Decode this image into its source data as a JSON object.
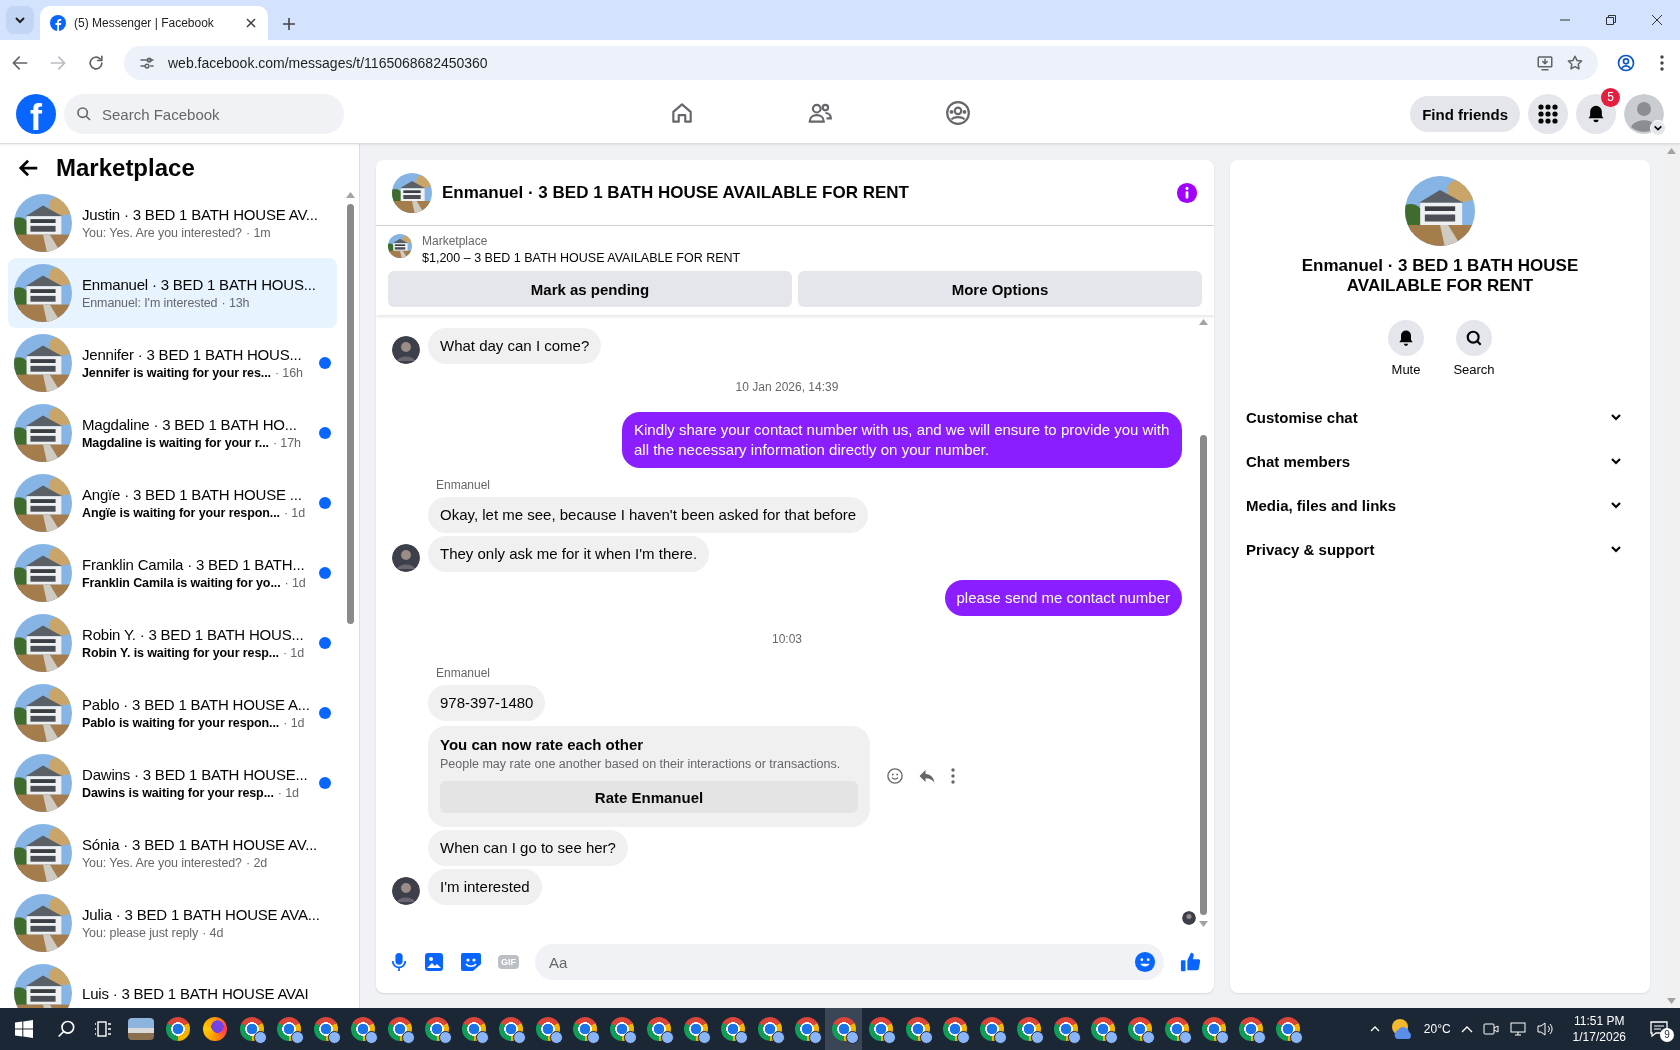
{
  "browser": {
    "tab_title": "(5) Messenger | Facebook",
    "url": "web.facebook.com/messages/t/1165068682450360"
  },
  "nav": {
    "logo": "f",
    "search_placeholder": "Search Facebook",
    "tabs": [
      {
        "kind": "home",
        "selected": false
      },
      {
        "kind": "friends",
        "selected": false
      },
      {
        "kind": "groups",
        "selected": false
      }
    ],
    "find_friends": "Find friends",
    "notification_count": "5"
  },
  "sidebar": {
    "title": "Marketplace",
    "chats": [
      {
        "title": "Justin · 3 BED 1 BATH HOUSE AV...",
        "preview": "You: Yes. Are you interested?",
        "time": "· 1m",
        "unread": false,
        "selected": false
      },
      {
        "title": "Enmanuel · 3 BED 1 BATH HOUS...",
        "preview": "Enmanuel: I'm interested",
        "time": "· 13h",
        "unread": false,
        "selected": true
      },
      {
        "title": "Jennifer · 3 BED 1 BATH HOUS...",
        "preview": "Jennifer is waiting for your res...",
        "time": "· 16h",
        "unread": true,
        "selected": false
      },
      {
        "title": "Magdaline · 3 BED 1 BATH HO...",
        "preview": "Magdaline is waiting for your r...",
        "time": "· 17h",
        "unread": true,
        "selected": false
      },
      {
        "title": "Angïe · 3 BED 1 BATH HOUSE ...",
        "preview": "Angïe is waiting for your respon...",
        "time": "· 1d",
        "unread": true,
        "selected": false
      },
      {
        "title": "Franklin Camila · 3 BED 1 BATH...",
        "preview": "Franklin Camila is waiting for yo...",
        "time": "· 1d",
        "unread": true,
        "selected": false
      },
      {
        "title": "Robin Y. · 3 BED 1 BATH HOUS...",
        "preview": "Robin Y. is waiting for your resp...",
        "time": "· 1d",
        "unread": true,
        "selected": false
      },
      {
        "title": "Pablo · 3 BED 1 BATH HOUSE A...",
        "preview": "Pablo is waiting for your respon...",
        "time": "· 1d",
        "unread": true,
        "selected": false
      },
      {
        "title": "Dawins · 3 BED 1 BATH HOUSE...",
        "preview": "Dawins is waiting for your resp...",
        "time": "· 1d",
        "unread": true,
        "selected": false
      },
      {
        "title": "Sónia · 3 BED 1 BATH HOUSE AV...",
        "preview": "You: Yes. Are you interested?",
        "time": "· 2d",
        "unread": false,
        "selected": false
      },
      {
        "title": "Julia · 3 BED 1 BATH HOUSE AVA...",
        "preview": "You: please just reply",
        "time": "· 4d",
        "unread": false,
        "selected": false
      },
      {
        "title": "Luis · 3 BED 1 BATH HOUSE AVAI",
        "unread": false,
        "selected": false
      }
    ]
  },
  "conversation": {
    "title": "Enmanuel · 3 BED 1 BATH HOUSE AVAILABLE FOR RENT",
    "listing": {
      "label": "Marketplace",
      "detail": "$1,200 – 3 BED 1 BATH HOUSE AVAILABLE FOR RENT"
    },
    "actions": [
      "Mark as pending",
      "More Options"
    ],
    "messages": [
      {
        "kind": "incoming",
        "text": "What day can I come?",
        "avatar": true
      },
      {
        "kind": "timestamp",
        "text": "10 Jan 2026, 14:39"
      },
      {
        "kind": "outgoing",
        "text": "Kindly share your contact number with us, and we will ensure to provide you with all the necessary information directly on your number."
      },
      {
        "kind": "sender",
        "text": "Enmanuel"
      },
      {
        "kind": "incoming",
        "text": "Okay, let me see, because I haven't been asked for that before",
        "avatar": false
      },
      {
        "kind": "incoming",
        "text": "They only ask me for it when I'm there.",
        "avatar": true
      },
      {
        "kind": "outgoing",
        "text": "please send me contact number"
      },
      {
        "kind": "timestamp",
        "text": "10:03"
      },
      {
        "kind": "sender",
        "text": "Enmanuel"
      },
      {
        "kind": "incoming",
        "text": "978-397-1480",
        "avatar": false
      },
      {
        "kind": "rating",
        "title": "You can now rate each other",
        "text": "People may rate one another based on their interactions or transactions.",
        "button": "Rate Enmanuel",
        "hovered": true
      },
      {
        "kind": "incoming",
        "text": "When can I go to see her?",
        "avatar": false
      },
      {
        "kind": "incoming",
        "text": "I'm interested",
        "avatar": true
      },
      {
        "kind": "seen"
      }
    ],
    "composer": {
      "gif": "GIF",
      "placeholder": "Aa"
    }
  },
  "details": {
    "title": "Enmanuel · 3 BED 1 BATH HOUSE AVAILABLE FOR RENT",
    "actions": [
      {
        "kind": "mute",
        "label": "Mute"
      },
      {
        "kind": "search",
        "label": "Search"
      }
    ],
    "sections": [
      "Customise chat",
      "Chat members",
      "Media, files and links",
      "Privacy & support"
    ]
  },
  "taskbar": {
    "apps": [
      {
        "kind": "thumbnail",
        "selected": false
      },
      {
        "kind": "chrome",
        "selected": false
      },
      {
        "kind": "firefox",
        "selected": false
      },
      {
        "kind": "chrome-profile",
        "selected": false
      },
      {
        "kind": "chrome-profile",
        "selected": false
      },
      {
        "kind": "chrome-profile",
        "selected": false
      },
      {
        "kind": "chrome-profile",
        "selected": false
      },
      {
        "kind": "chrome-profile",
        "selected": false
      },
      {
        "kind": "chrome-profile",
        "selected": false
      },
      {
        "kind": "chrome-profile",
        "selected": false
      },
      {
        "kind": "chrome-profile",
        "selected": false
      },
      {
        "kind": "chrome-profile",
        "selected": false
      },
      {
        "kind": "chrome-profile",
        "selected": false
      },
      {
        "kind": "chrome-profile",
        "selected": false
      },
      {
        "kind": "chrome-profile",
        "selected": false
      },
      {
        "kind": "chrome-profile",
        "selected": false
      },
      {
        "kind": "chrome-profile",
        "selected": false
      },
      {
        "kind": "chrome-profile",
        "selected": false
      },
      {
        "kind": "chrome-profile",
        "selected": false
      },
      {
        "kind": "chrome-profile",
        "selected": true
      },
      {
        "kind": "chrome-profile",
        "selected": false
      },
      {
        "kind": "chrome-profile",
        "selected": false
      },
      {
        "kind": "chrome-profile",
        "selected": false
      },
      {
        "kind": "chrome-profile",
        "selected": false
      },
      {
        "kind": "chrome-profile",
        "selected": false
      },
      {
        "kind": "chrome-profile",
        "selected": false
      },
      {
        "kind": "chrome-profile",
        "selected": false
      },
      {
        "kind": "chrome-profile",
        "selected": false
      },
      {
        "kind": "chrome-profile",
        "selected": false
      },
      {
        "kind": "chrome-profile",
        "selected": false
      },
      {
        "kind": "chrome-profile",
        "selected": false
      },
      {
        "kind": "chrome-profile",
        "selected": false
      }
    ],
    "temperature": "20°C",
    "time": "11:51 PM",
    "date": "1/17/2026",
    "notifications": "9"
  }
}
